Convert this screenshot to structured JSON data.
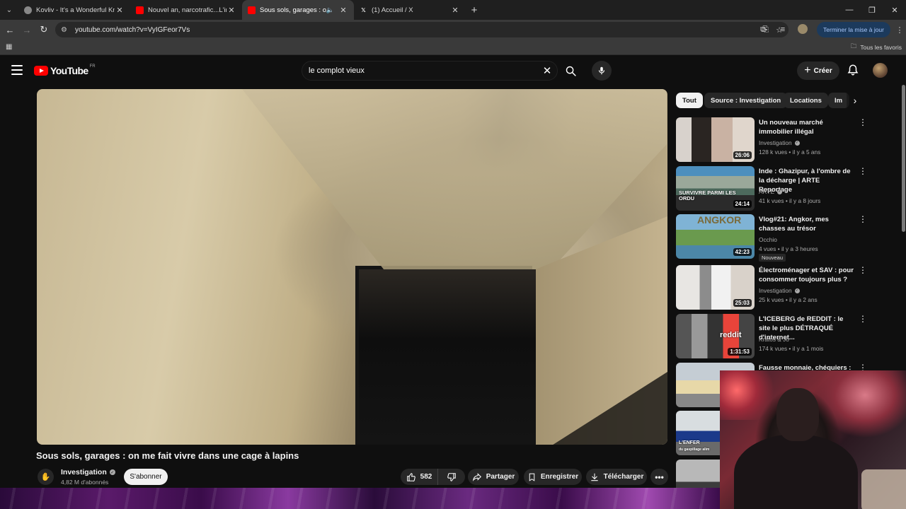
{
  "browser": {
    "tabs": [
      {
        "title": "Kovliv - It's a Wonderful Knife (",
        "favicon": "globe-icon",
        "active": false
      },
      {
        "title": "Nouvel an, narcotrafic...L'intervi",
        "favicon": "youtube-icon",
        "active": false
      },
      {
        "title": "Sous sols, garages : on me",
        "favicon": "youtube-icon",
        "active": true
      },
      {
        "title": "(1) Accueil / X",
        "favicon": "x-icon",
        "active": false
      }
    ],
    "url": "youtube.com/watch?v=VyIGFeor7Vs",
    "update_button": "Terminer la mise à jour",
    "bookmarks_all": "Tous les favoris"
  },
  "youtube": {
    "logo_text": "YouTube",
    "region": "FR",
    "search_query": "le complot vieux",
    "create_label": "Créer"
  },
  "video": {
    "title": "Sous sols, garages : on me fait vivre dans une cage à lapins",
    "channel": "Investigation",
    "subscribers": "4,82 M d'abonnés",
    "subscribe_label": "S'abonner",
    "likes": "582",
    "share_label": "Partager",
    "save_label": "Enregistrer",
    "download_label": "Télécharger"
  },
  "chips": [
    "Tout",
    "Source : Investigation",
    "Locations",
    "Im"
  ],
  "recommendations": [
    {
      "title": "Un nouveau marché immobilier illégal",
      "channel": "Investigation",
      "verified": true,
      "meta": "128 k vues • il y a 5 ans",
      "duration": "26:06",
      "badge": ""
    },
    {
      "title": "Inde : Ghazipur, à l'ombre de la décharge | ARTE Reportage",
      "channel": "ARTE",
      "verified": true,
      "meta": "41 k vues • il y a 8 jours",
      "duration": "24:14",
      "badge": "",
      "thumb_text": "SURVIVRE PARMI LES ORDU"
    },
    {
      "title": "Vlog#21: Angkor, mes chasses au trésor",
      "channel": "Occhio",
      "verified": false,
      "meta": "4 vues • il y a 3 heures",
      "duration": "42:23",
      "badge": "Nouveau",
      "thumb_text": "ANGKOR"
    },
    {
      "title": "Électroménager et SAV : pour consommer toujours plus ?",
      "channel": "Investigation",
      "verified": true,
      "meta": "25 k vues • il y a 2 ans",
      "duration": "25:03",
      "badge": ""
    },
    {
      "title": "L'ICEBERG de REDDIT : le site le plus DÉTRAQUÉ d'internet...",
      "channel": "Kratos & Jo",
      "verified": false,
      "meta": "174 k vues • il y a 1 mois",
      "duration": "1:31:53",
      "badge": "",
      "thumb_text": "reddit"
    },
    {
      "title": "Fausse monnaie, chéquiers :",
      "channel": "",
      "verified": false,
      "meta": "",
      "duration": "",
      "badge": ""
    }
  ],
  "thumb_extra": {
    "enfer": "L'ENFER",
    "enfer_sub": "du gaspillage alim"
  }
}
